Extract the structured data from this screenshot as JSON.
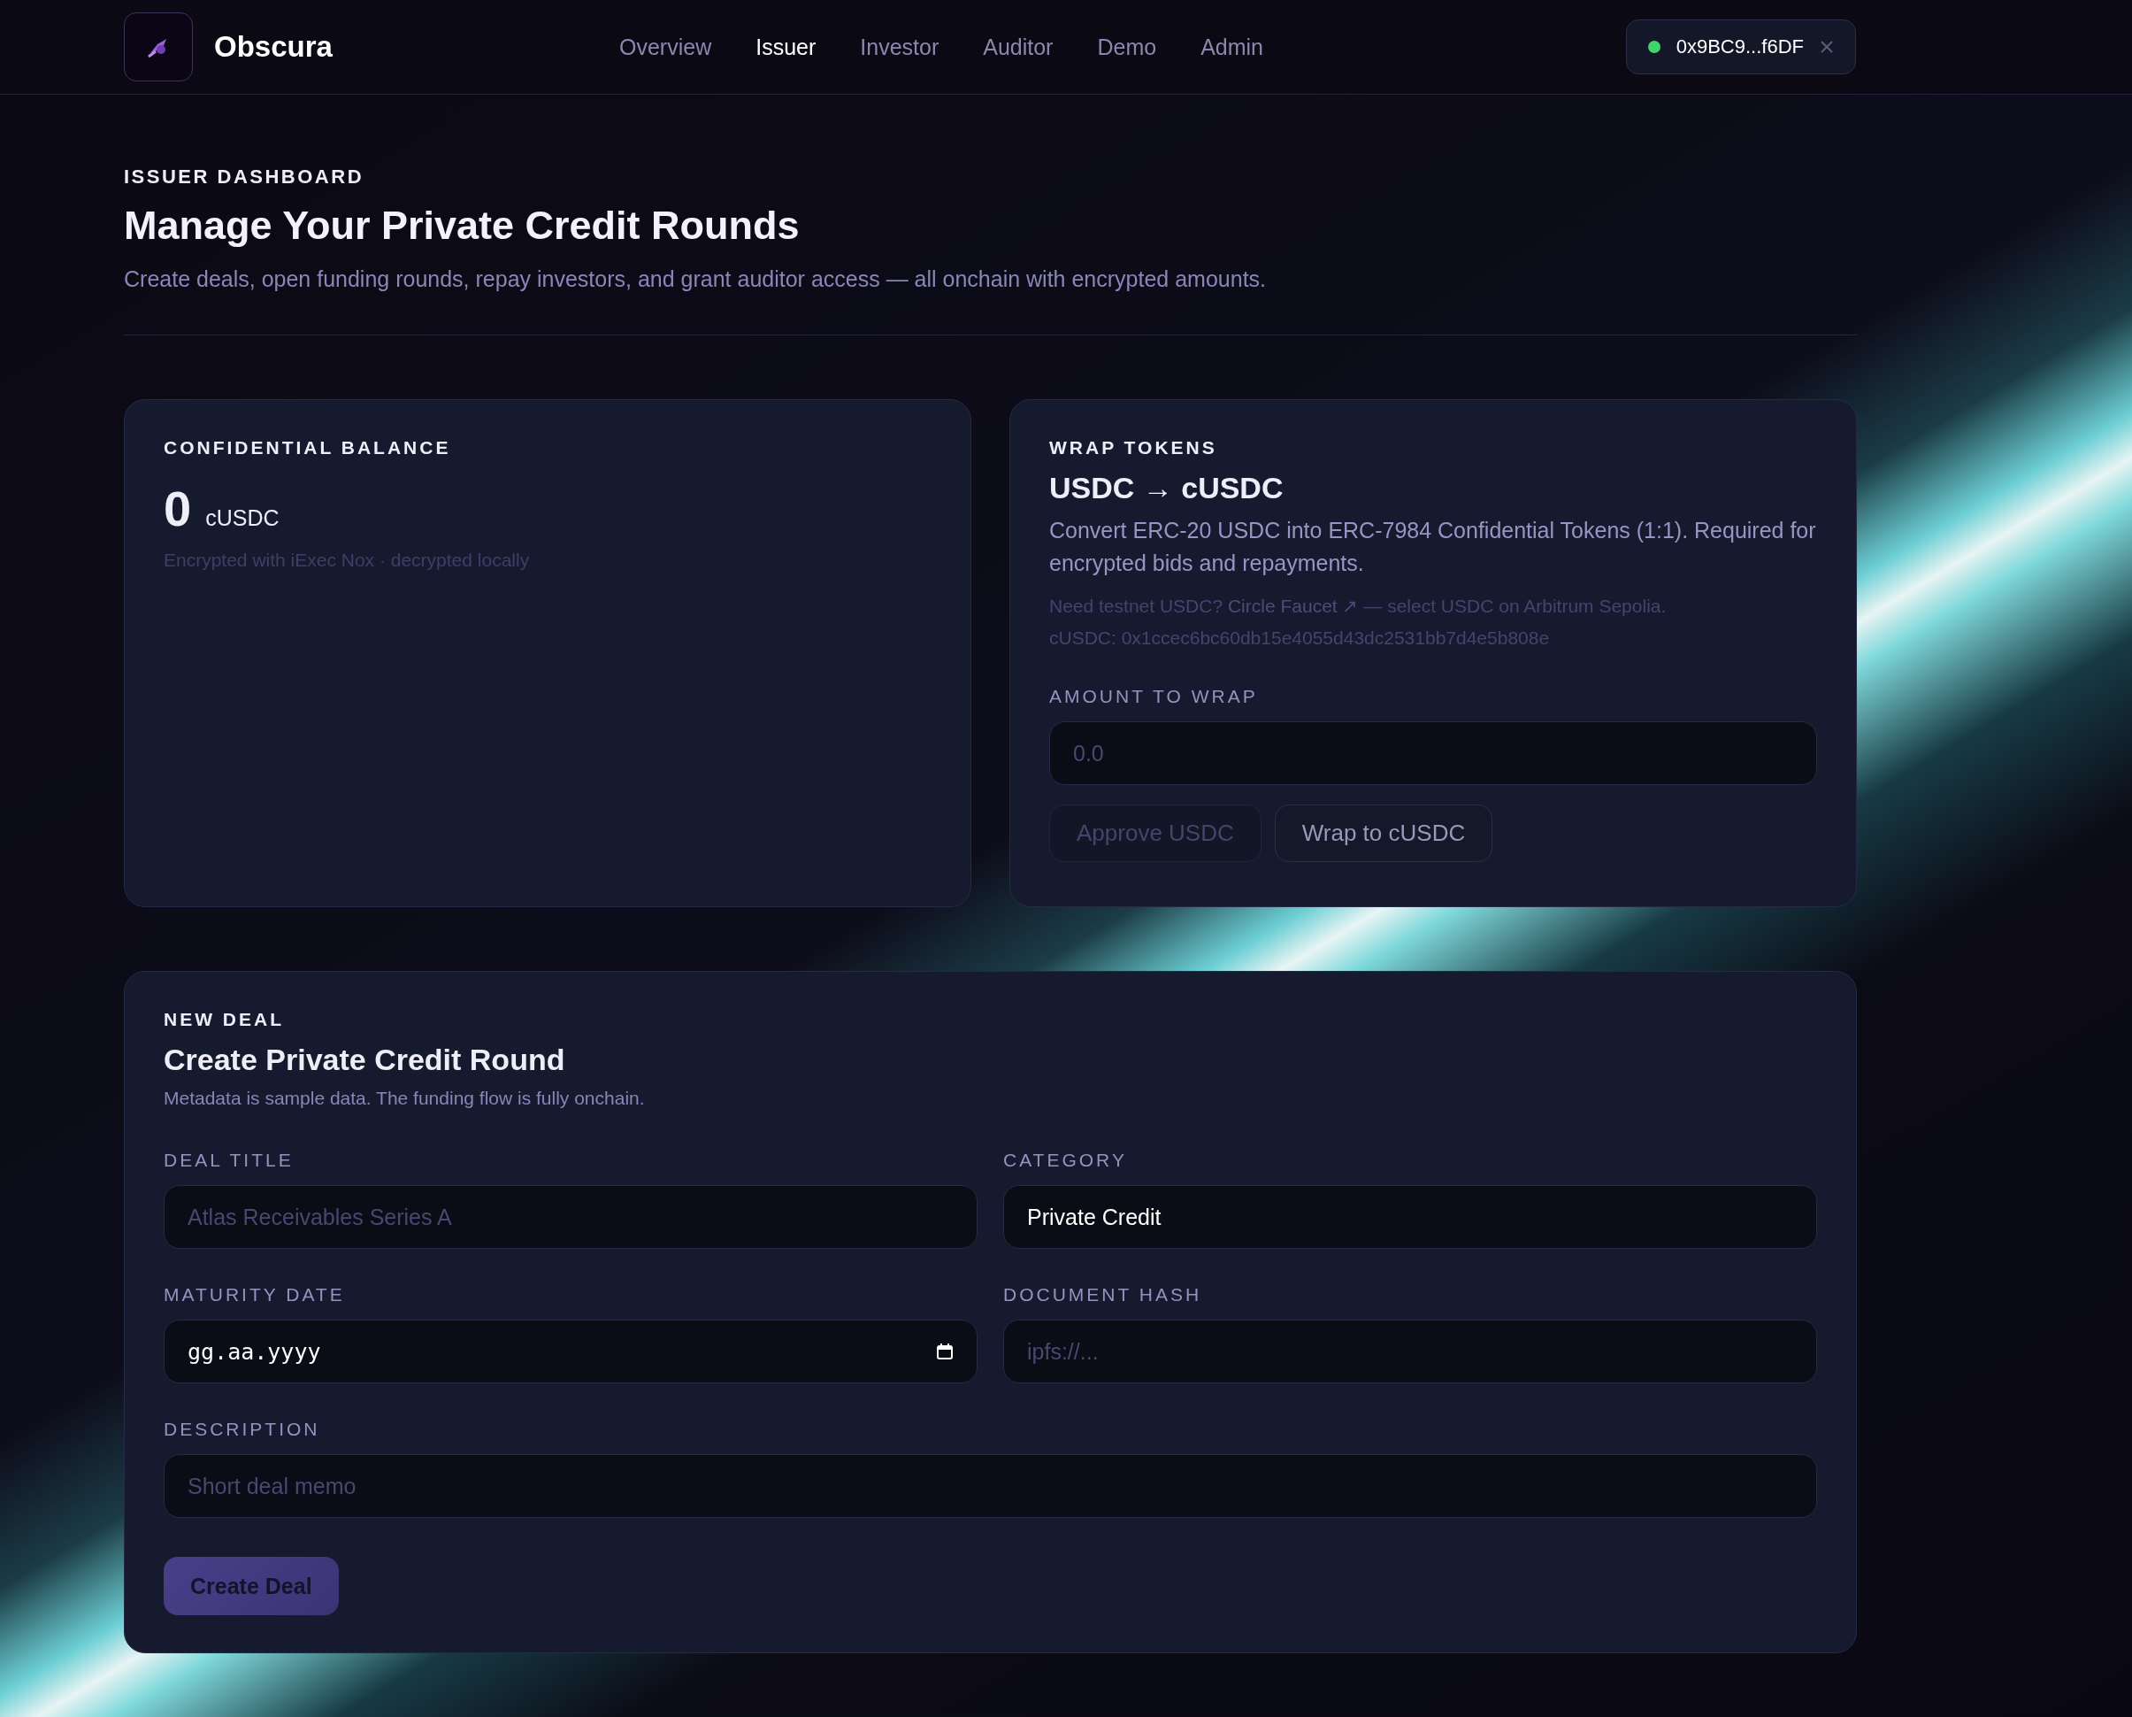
{
  "header": {
    "brand": "Obscura",
    "nav": [
      {
        "label": "Overview",
        "selected": false
      },
      {
        "label": "Issuer",
        "selected": true
      },
      {
        "label": "Investor",
        "selected": false
      },
      {
        "label": "Auditor",
        "selected": false
      },
      {
        "label": "Demo",
        "selected": false
      },
      {
        "label": "Admin",
        "selected": false
      }
    ],
    "wallet": {
      "address": "0x9BC9...f6DF",
      "connected": true
    }
  },
  "page": {
    "eyebrow": "ISSUER DASHBOARD",
    "title": "Manage Your Private Credit Rounds",
    "description": "Create deals, open funding rounds, repay investors, and grant auditor access — all onchain with encrypted amounts."
  },
  "balance_card": {
    "label": "CONFIDENTIAL BALANCE",
    "amount": "0",
    "unit": "cUSDC",
    "note": "Encrypted with iExec Nox · decrypted locally"
  },
  "wrap_card": {
    "label": "WRAP TOKENS",
    "title": "USDC → cUSDC",
    "description": "Convert ERC-20 USDC into ERC-7984 Confidential Tokens (1:1). Required for encrypted bids and repayments.",
    "hint_prefix": "Need testnet USDC?",
    "hint_link": "Circle Faucet ↗",
    "hint_suffix": "— select USDC on Arbitrum Sepolia.",
    "contract": "cUSDC: 0x1ccec6bc60db15e4055d43dc2531bb7d4e5b808e",
    "amount_label": "AMOUNT TO WRAP",
    "amount_placeholder": "0.0",
    "buttons": [
      {
        "label": "Approve USDC",
        "disabled": true
      },
      {
        "label": "Wrap to cUSDC",
        "disabled": false
      }
    ]
  },
  "deal_card": {
    "label": "NEW DEAL",
    "title": "Create Private Credit Round",
    "subtitle": "Metadata is sample data. The funding flow is fully onchain.",
    "fields": [
      {
        "kind": "text",
        "label": "DEAL TITLE",
        "placeholder": "Atlas Receivables Series A"
      },
      {
        "kind": "text",
        "label": "CATEGORY",
        "value": "Private Credit"
      },
      {
        "kind": "date",
        "label": "MATURITY DATE",
        "value": "gg.aa.yyyy"
      },
      {
        "kind": "text",
        "label": "DOCUMENT HASH",
        "placeholder": "ipfs://..."
      },
      {
        "kind": "wide",
        "label": "DESCRIPTION",
        "placeholder": "Short deal memo"
      }
    ],
    "submit": "Create Deal"
  }
}
